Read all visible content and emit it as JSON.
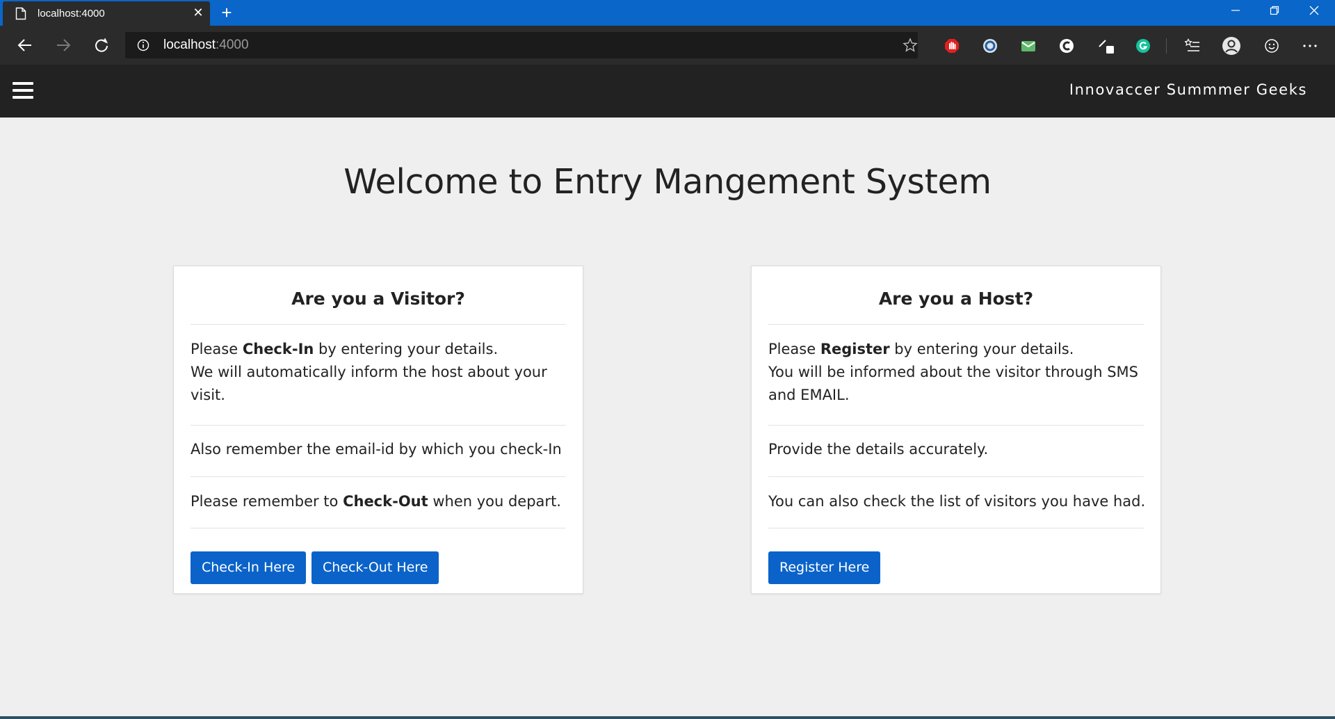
{
  "browser": {
    "tab_title": "localhost:4000",
    "tab_close_glyph": "✕",
    "new_tab_glyph": "+",
    "url_host": "localhost",
    "url_port": ":4000",
    "icons": [
      "page-icon",
      "back-icon",
      "forward-icon",
      "refresh-icon",
      "info-icon",
      "favorite-star-icon",
      "minimize-icon",
      "restore-icon",
      "close-window-icon",
      "collections-icon",
      "profile-icon",
      "feedback-icon",
      "more-icon"
    ],
    "colors": {
      "tabstrip": "#0a66c8",
      "toolbar": "#2b2b2b",
      "address_bar": "#1b1b1b"
    }
  },
  "app": {
    "brand": "Innovaccer Summmer Geeks",
    "page_title": "Welcome to Entry Mangement System",
    "colors": {
      "appbar": "#222222",
      "background": "#efefef",
      "button": "#0b63c9"
    }
  },
  "visitor_card": {
    "title": "Are you a Visitor?",
    "intro_prefix": "Please ",
    "intro_bold": "Check-In",
    "intro_suffix": " by entering your details.",
    "intro_line2": "We will automatically inform the host about your visit.",
    "note1": "Also remember the email-id by which you check-In",
    "note2_prefix": "Please remember to ",
    "note2_bold": "Check-Out",
    "note2_suffix": " when you depart.",
    "checkin_button": "Check-In Here",
    "checkout_button": "Check-Out Here"
  },
  "host_card": {
    "title": "Are you a Host?",
    "intro_prefix": "Please ",
    "intro_bold": "Register",
    "intro_suffix": " by entering your details.",
    "intro_line2": "You will be informed about the visitor through SMS and EMAIL.",
    "note1": "Provide the details accurately.",
    "note2": "You can also check the list of visitors you have had.",
    "register_button": "Register Here"
  }
}
